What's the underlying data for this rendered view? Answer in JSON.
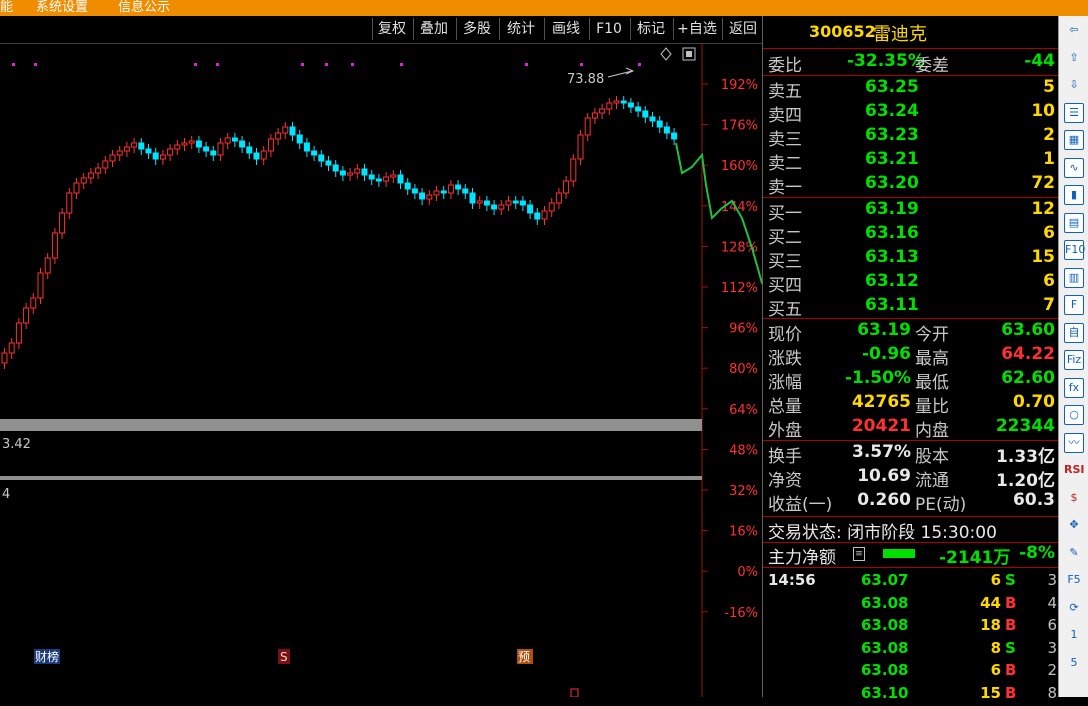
{
  "topbar": {
    "items": [
      "能",
      "系统设置",
      "信息公示"
    ]
  },
  "toolbar": {
    "buttons": [
      "复权",
      "叠加",
      "多股",
      "统计",
      "画线",
      "F10",
      "标记",
      "+自选",
      "返回"
    ]
  },
  "chart": {
    "y_axis_labels": [
      "192%",
      "176%",
      "160%",
      "144%",
      "128%",
      "112%",
      "96%",
      "80%",
      "64%",
      "48%",
      "32%",
      "16%",
      "0%",
      "-16%"
    ],
    "high_marker": "73.88",
    "indicator_value_1": "3.42",
    "indicator_value_2": "4",
    "event_badges": [
      "财榜",
      "S",
      "预"
    ],
    "up_color": "#ff3030",
    "down_color": "#00e5ff",
    "annotation_color": "#20c040"
  },
  "quote": {
    "code": "300652",
    "name": "雷迪克",
    "weibi_label": "委比",
    "weibi": "-32.35%",
    "weicha_label": "委差",
    "weicha": "-44",
    "sells": [
      {
        "label": "卖五",
        "price": "63.25",
        "vol": "5"
      },
      {
        "label": "卖四",
        "price": "63.24",
        "vol": "10"
      },
      {
        "label": "卖三",
        "price": "63.23",
        "vol": "2"
      },
      {
        "label": "卖二",
        "price": "63.21",
        "vol": "1"
      },
      {
        "label": "卖一",
        "price": "63.20",
        "vol": "72"
      }
    ],
    "buys": [
      {
        "label": "买一",
        "price": "63.19",
        "vol": "12"
      },
      {
        "label": "买二",
        "price": "63.16",
        "vol": "6"
      },
      {
        "label": "买三",
        "price": "63.13",
        "vol": "15"
      },
      {
        "label": "买四",
        "price": "63.12",
        "vol": "6"
      },
      {
        "label": "买五",
        "price": "63.11",
        "vol": "7"
      }
    ],
    "stats": [
      {
        "l1": "现价",
        "v1": "63.19",
        "c1": "grn",
        "l2": "今开",
        "v2": "63.60",
        "c2": "grn"
      },
      {
        "l1": "涨跌",
        "v1": "-0.96",
        "c1": "grn",
        "l2": "最高",
        "v2": "64.22",
        "c2": "red"
      },
      {
        "l1": "涨幅",
        "v1": "-1.50%",
        "c1": "grn",
        "l2": "最低",
        "v2": "62.60",
        "c2": "grn"
      },
      {
        "l1": "总量",
        "v1": "42765",
        "c1": "yel",
        "l2": "量比",
        "v2": "0.70",
        "c2": "yel"
      },
      {
        "l1": "外盘",
        "v1": "20421",
        "c1": "red",
        "l2": "内盘",
        "v2": "22344",
        "c2": "grn"
      }
    ],
    "stats2": [
      {
        "l1": "换手",
        "v1": "3.57%",
        "l2": "股本",
        "v2": "1.33亿"
      },
      {
        "l1": "净资",
        "v1": "10.69",
        "l2": "流通",
        "v2": "1.20亿"
      },
      {
        "l1": "收益(一)",
        "v1": "0.260",
        "l2": "PE(动)",
        "v2": "60.3"
      }
    ],
    "trade_state": "交易状态: 闭市阶段 15:30:00",
    "main_flow_label": "主力净额",
    "main_flow_value": "-2141万",
    "main_flow_pct": "-8%",
    "ticks": [
      {
        "time": "14:56",
        "price": "63.07",
        "vol": "6",
        "flag": "S",
        "cnt": "3"
      },
      {
        "time": "",
        "price": "63.08",
        "vol": "44",
        "flag": "B",
        "cnt": "4"
      },
      {
        "time": "",
        "price": "63.08",
        "vol": "18",
        "flag": "B",
        "cnt": "6"
      },
      {
        "time": "",
        "price": "63.08",
        "vol": "8",
        "flag": "S",
        "cnt": "3"
      },
      {
        "time": "",
        "price": "63.08",
        "vol": "6",
        "flag": "B",
        "cnt": "2"
      },
      {
        "time": "",
        "price": "63.10",
        "vol": "15",
        "flag": "B",
        "cnt": "8"
      }
    ]
  },
  "sidebar": {
    "items": [
      "⇦",
      "⇧",
      "⇩",
      "☰",
      "▦",
      "∿",
      "▮",
      "▤",
      "F10",
      "▥",
      "F",
      "自",
      "Fiz",
      "fx",
      "○",
      "〰",
      "RSI",
      "$",
      "✥",
      "✎",
      "F5",
      "⟳",
      "1",
      "5"
    ]
  }
}
